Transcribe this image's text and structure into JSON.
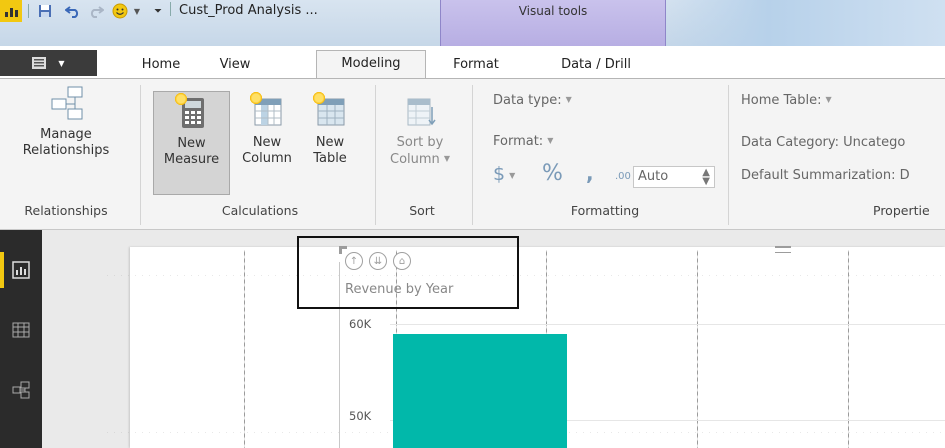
{
  "window": {
    "title": "Cust_Prod Analysis ...",
    "contextual_tab_group": "Visual tools"
  },
  "tabs": [
    {
      "label": "Home",
      "active": false
    },
    {
      "label": "View",
      "active": false
    },
    {
      "label": "Modeling",
      "active": true
    },
    {
      "label": "Format",
      "active": false
    },
    {
      "label": "Data / Drill",
      "active": false
    }
  ],
  "ribbon": {
    "relationships": {
      "manage_label_1": "Manage",
      "manage_label_2": "Relationships",
      "group_label": "Relationships"
    },
    "calculations": {
      "new_measure_1": "New",
      "new_measure_2": "Measure",
      "new_column_1": "New",
      "new_column_2": "Column",
      "new_table_1": "New",
      "new_table_2": "Table",
      "group_label": "Calculations"
    },
    "sort": {
      "sort_by_1": "Sort by",
      "sort_by_2": "Column",
      "group_label": "Sort"
    },
    "formatting": {
      "data_type": "Data type:",
      "format": "Format:",
      "currency": "$",
      "percent": "%",
      "comma": ",",
      "decimals_icon": ".00",
      "auto_value": "Auto",
      "group_label": "Formatting"
    },
    "properties": {
      "home_table": "Home Table:",
      "data_category": "Data Category: Uncatego",
      "default_summarization": "Default Summarization: D",
      "group_label": "Propertie"
    }
  },
  "canvas": {
    "chart_title": "Revenue by Year",
    "visual_header_icons": [
      "drill-up-icon",
      "drill-down-all-icon",
      "expand-hierarchy-icon"
    ]
  },
  "chart_data": {
    "type": "bar",
    "title": "Revenue by Year",
    "yticks": [
      "60K",
      "50K"
    ],
    "visible_bar_color": "#01b8aa",
    "values": [
      59000
    ]
  },
  "colors": {
    "accent": "#f2c811",
    "bar": "#01b8aa",
    "contextual_band": "#c4bcea",
    "nav_bg": "#2b2b2b"
  }
}
